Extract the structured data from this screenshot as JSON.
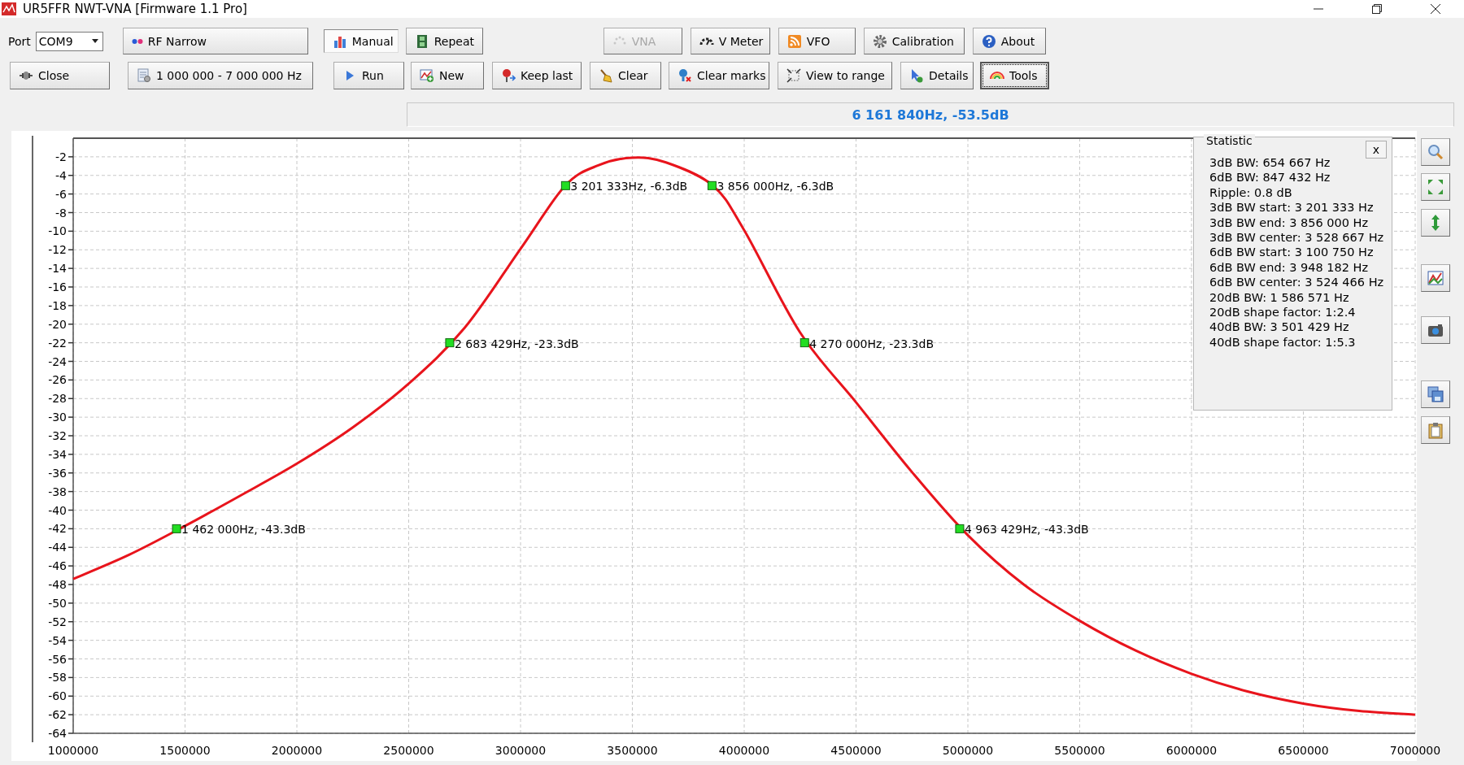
{
  "window": {
    "title": "UR5FFR NWT-VNA [Firmware 1.1 Pro]"
  },
  "port": {
    "label": "Port",
    "value": "COM9"
  },
  "toolbar_row_1": [
    {
      "label": "RF Narrow",
      "disabled": false,
      "pressed": false,
      "focused": false
    },
    {
      "label": "Manual",
      "disabled": false,
      "pressed": true,
      "focused": false
    },
    {
      "label": "Repeat",
      "disabled": false,
      "pressed": false,
      "focused": false
    },
    {
      "label": "VNA",
      "disabled": true,
      "pressed": false,
      "focused": false
    },
    {
      "label": "V Meter",
      "disabled": false,
      "pressed": false,
      "focused": false
    },
    {
      "label": "VFO",
      "disabled": false,
      "pressed": false,
      "focused": false
    },
    {
      "label": "Calibration",
      "disabled": false,
      "pressed": false,
      "focused": false
    },
    {
      "label": "About",
      "disabled": false,
      "pressed": false,
      "focused": false
    }
  ],
  "toolbar_row_2": [
    {
      "label": "Close",
      "disabled": false,
      "pressed": false,
      "focused": false
    },
    {
      "label": "1 000 000 - 7 000 000 Hz",
      "disabled": false,
      "pressed": false,
      "focused": false
    },
    {
      "label": "Run",
      "disabled": false,
      "pressed": false,
      "focused": false
    },
    {
      "label": "New",
      "disabled": false,
      "pressed": false,
      "focused": false
    },
    {
      "label": "Keep last",
      "disabled": false,
      "pressed": false,
      "focused": false
    },
    {
      "label": "Clear",
      "disabled": false,
      "pressed": false,
      "focused": false
    },
    {
      "label": "Clear marks",
      "disabled": false,
      "pressed": false,
      "focused": false
    },
    {
      "label": "View to range",
      "disabled": false,
      "pressed": false,
      "focused": false
    },
    {
      "label": "Details",
      "disabled": false,
      "pressed": false,
      "focused": false
    },
    {
      "label": "Tools",
      "disabled": false,
      "pressed": false,
      "focused": true
    }
  ],
  "readout": "6 161 840Hz, -53.5dB",
  "chart": {
    "chart_data": {
      "type": "line",
      "x": [
        1000000,
        1250000,
        1500000,
        1750000,
        2000000,
        2250000,
        2500000,
        2750000,
        3000000,
        3200000,
        3350000,
        3500000,
        3650000,
        3860000,
        4000000,
        4250000,
        4500000,
        4750000,
        5000000,
        5250000,
        5500000,
        5750000,
        6000000,
        6250000,
        6500000,
        6750000,
        7000000
      ],
      "series": [
        {
          "color": "#e8141c",
          "values": [
            -47.4,
            -44.8,
            -41.7,
            -38.4,
            -35,
            -31.1,
            -26.4,
            -20.4,
            -11.9,
            -5.1,
            -2.9,
            -2.1,
            -2.6,
            -5.1,
            -9.9,
            -20.9,
            -28.4,
            -35.9,
            -42.7,
            -48,
            -51.9,
            -55.1,
            -57.6,
            -59.5,
            -60.8,
            -61.6,
            -62
          ]
        }
      ],
      "xlim": [
        1000000,
        7000000
      ],
      "ylim": [
        -64,
        0
      ],
      "grid": true,
      "xticks": [
        1000000,
        1500000,
        2000000,
        2500000,
        3000000,
        3500000,
        4000000,
        4500000,
        5000000,
        5500000,
        6000000,
        6500000,
        7000000
      ],
      "yticks": [
        -2,
        -4,
        -6,
        -8,
        -10,
        -12,
        -14,
        -16,
        -18,
        -20,
        -22,
        -24,
        -26,
        -28,
        -30,
        -32,
        -34,
        -36,
        -38,
        -40,
        -42,
        -44,
        -46,
        -48,
        -50,
        -52,
        -54,
        -56,
        -58,
        -60,
        -62,
        -64
      ],
      "annotations": [
        {
          "x": 1462000,
          "y": -42,
          "text": "1 462 000Hz, -43.3dB"
        },
        {
          "x": 2683429,
          "y": -22,
          "text": "2 683 429Hz, -23.3dB"
        },
        {
          "x": 3201333,
          "y": -5.1,
          "text": "3 201 333Hz, -6.3dB"
        },
        {
          "x": 3856000,
          "y": -5.1,
          "text": "3 856 000Hz, -6.3dB"
        },
        {
          "x": 4270000,
          "y": -22,
          "text": "4 270 000Hz, -23.3dB"
        },
        {
          "x": 4963429,
          "y": -42,
          "text": "4 963 429Hz, -43.3dB"
        }
      ]
    }
  },
  "statistic": {
    "title": "Statistic",
    "close": "x",
    "lines": [
      "3dB BW: 654 667 Hz",
      "6dB BW: 847 432 Hz",
      "Ripple: 0.8 dB",
      "3dB BW start: 3 201 333 Hz",
      "3dB BW end: 3 856 000 Hz",
      "3dB BW center: 3 528 667 Hz",
      "6dB BW start: 3 100 750 Hz",
      "6dB BW end: 3 948 182 Hz",
      "6dB BW center: 3 524 466 Hz",
      "20dB BW: 1 586 571 Hz",
      "20dB shape factor: 1:2.4",
      "40dB BW: 3 501 429 Hz",
      "40dB shape factor: 1:5.3"
    ]
  }
}
